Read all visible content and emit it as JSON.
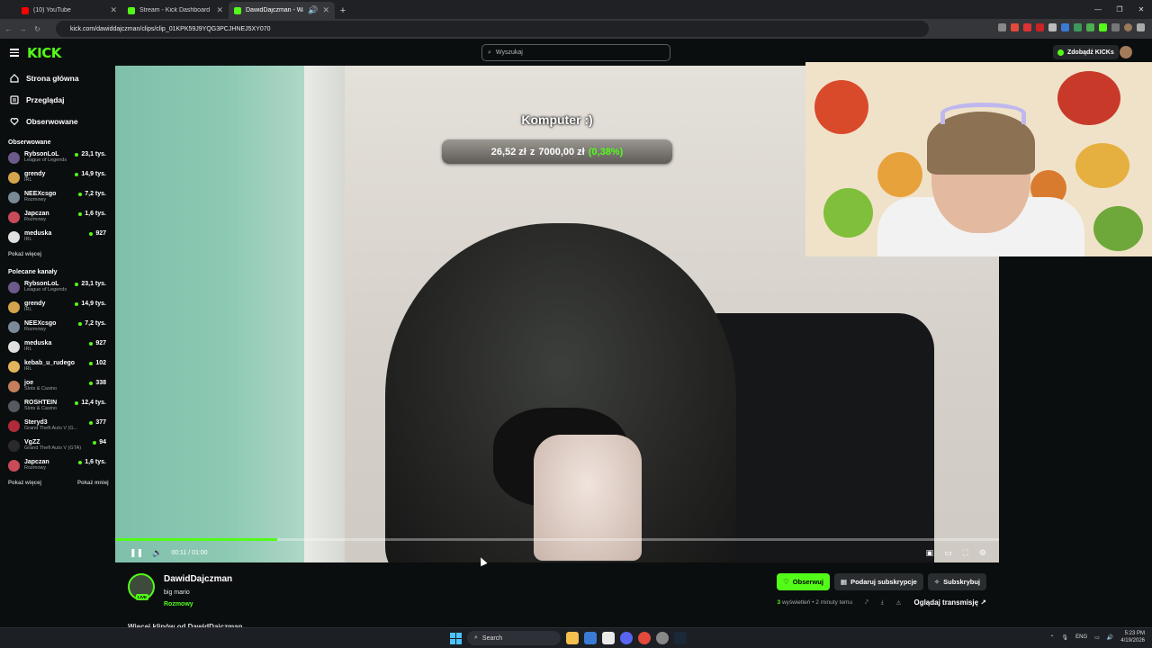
{
  "browser": {
    "tabs": [
      {
        "label": "(10) YouTube",
        "color": "#ff0000"
      },
      {
        "label": "Stream - Kick Dashboard",
        "color": "#53fc18"
      },
      {
        "label": "DawidDajczman - Watch cli",
        "color": "#53fc18"
      }
    ],
    "url": "kick.com/dawiddajczman/clips/clip_01KPK59J9YQG3PCJHNEJ5XY070"
  },
  "header": {
    "logo": "KICK",
    "search_placeholder": "Wyszukaj",
    "kicks_button": "Zdobądź KICKs"
  },
  "sidebar": {
    "nav": [
      {
        "label": "Strona główna",
        "icon": "home-icon"
      },
      {
        "label": "Przeglądaj",
        "icon": "browse-icon"
      },
      {
        "label": "Obserwowane",
        "icon": "heart-icon"
      }
    ],
    "followed_title": "Obserwowane",
    "followed": [
      {
        "name": "RybsonLoL",
        "category": "League of Legends",
        "viewers": "23,1 tys.",
        "color": "#6b5a8a"
      },
      {
        "name": "grendy",
        "category": "IRL",
        "viewers": "14,9 tys.",
        "color": "#d4a54a"
      },
      {
        "name": "NEEXcsgo",
        "category": "Rozmowy",
        "viewers": "7,2 tys.",
        "color": "#7a8a99"
      },
      {
        "name": "Japczan",
        "category": "Rozmowy",
        "viewers": "1,6 tys.",
        "color": "#c94b5a"
      },
      {
        "name": "meduska",
        "category": "IRL",
        "viewers": "927",
        "color": "#e0e0e0"
      }
    ],
    "followed_more": "Pokaż więcej",
    "recommended_title": "Polecane kanały",
    "recommended": [
      {
        "name": "RybsonLoL",
        "category": "League of Legends",
        "viewers": "23,1 tys.",
        "color": "#6b5a8a"
      },
      {
        "name": "grendy",
        "category": "IRL",
        "viewers": "14,9 tys.",
        "color": "#d4a54a"
      },
      {
        "name": "NEEXcsgo",
        "category": "Rozmowy",
        "viewers": "7,2 tys.",
        "color": "#7a8a99"
      },
      {
        "name": "meduska",
        "category": "IRL",
        "viewers": "927",
        "color": "#e0e0e0"
      },
      {
        "name": "kebab_u_rudego",
        "category": "IRL",
        "viewers": "102",
        "color": "#e2b45b"
      },
      {
        "name": "joe",
        "category": "Slots & Casino",
        "viewers": "338",
        "color": "#c47f5a"
      },
      {
        "name": "ROSHTEIN",
        "category": "Slots & Casino",
        "viewers": "12,4 tys.",
        "color": "#555a60"
      },
      {
        "name": "Steryd3",
        "category": "Grand Theft Auto V (G...",
        "viewers": "377",
        "color": "#b02a3a"
      },
      {
        "name": "VgZZ",
        "category": "Grand Theft Auto V (GTA)",
        "viewers": "94",
        "color": "#2a2a2a"
      },
      {
        "name": "Japczan",
        "category": "Rozmowy",
        "viewers": "1,6 tys.",
        "color": "#c94b5a"
      }
    ],
    "recommended_more": "Pokaż więcej",
    "recommended_less": "Pokaż mniej"
  },
  "player": {
    "goal_title": "Komputer :)",
    "goal_current": "26,52 zł",
    "goal_sep": "z",
    "goal_target": "7000,00 zł",
    "goal_pct": "(0,38%)",
    "progress": 0.183,
    "time": "00:11 / 01:00"
  },
  "channel": {
    "name": "DawidDajczman",
    "clip_title": "big mario",
    "category": "Rozmowy",
    "live": "LIVE",
    "follow": "Obserwuj",
    "gift": "Podaruj subskrypcje",
    "subscribe": "Subskrybuj",
    "views_count": "3",
    "views_label": "wyświetleń",
    "time_ago": "• 2 minuty temu",
    "watch_stream": "Oglądaj transmisję",
    "more_clips": "Więcej klipów od DawidDajczman"
  },
  "taskbar": {
    "search": "Search",
    "lang": "ENG",
    "time": "5:23 PM",
    "date": "4/19/2026"
  },
  "colors": {
    "accent": "#53fc18",
    "bg": "#0b0e0f"
  }
}
